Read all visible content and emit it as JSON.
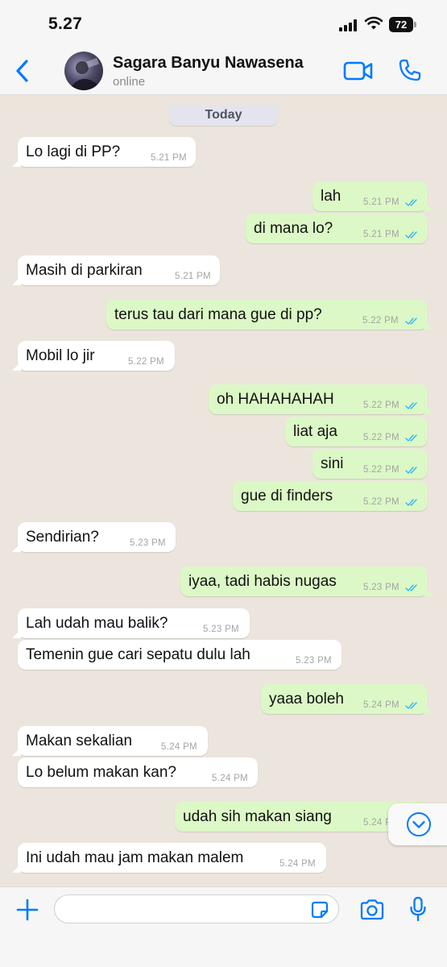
{
  "status_bar": {
    "time": "5.27",
    "battery": "72"
  },
  "header": {
    "contact_name": "Sagara Banyu Nawasena",
    "contact_status": "online"
  },
  "chat": {
    "date_label": "Today",
    "messages": [
      {
        "dir": "in",
        "text": "Lo lagi di PP?",
        "time": "5.21 PM"
      },
      {
        "dir": "out",
        "text": "lah",
        "time": "5.21 PM",
        "read": true
      },
      {
        "dir": "out",
        "text": "di mana lo?",
        "time": "5.21 PM",
        "read": true
      },
      {
        "dir": "in",
        "text": "Masih di parkiran",
        "time": "5.21 PM"
      },
      {
        "dir": "out",
        "text": "terus tau dari mana gue di pp?",
        "time": "5.22 PM",
        "read": true
      },
      {
        "dir": "in",
        "text": "Mobil lo jir",
        "time": "5.22 PM"
      },
      {
        "dir": "out",
        "text": "oh HAHAHAHAH",
        "time": "5.22 PM",
        "read": true
      },
      {
        "dir": "out",
        "text": "liat aja",
        "time": "5.22 PM",
        "read": true
      },
      {
        "dir": "out",
        "text": "sini",
        "time": "5.22 PM",
        "read": true
      },
      {
        "dir": "out",
        "text": "gue di finders",
        "time": "5.22 PM",
        "read": true
      },
      {
        "dir": "in",
        "text": "Sendirian?",
        "time": "5.23 PM"
      },
      {
        "dir": "out",
        "text": "iyaa, tadi habis nugas",
        "time": "5.23 PM",
        "read": true
      },
      {
        "dir": "in",
        "text": "Lah udah mau balik?",
        "time": "5.23 PM"
      },
      {
        "dir": "in",
        "text": "Temenin gue cari sepatu dulu lah",
        "time": "5.23 PM"
      },
      {
        "dir": "out",
        "text": "yaaa boleh",
        "time": "5.24 PM",
        "read": true
      },
      {
        "dir": "in",
        "text": "Makan sekalian",
        "time": "5.24 PM"
      },
      {
        "dir": "in",
        "text": "Lo belum makan kan?",
        "time": "5.24 PM"
      },
      {
        "dir": "out",
        "text": "udah sih makan siang",
        "time": "5.24 PM",
        "read": true
      },
      {
        "dir": "in",
        "text": "Ini udah mau jam makan malem",
        "time": "5.24 PM"
      }
    ]
  },
  "input_bar": {
    "placeholder": "",
    "value": ""
  },
  "colors": {
    "accent": "#007aff",
    "incoming_bubble": "#ffffff",
    "outgoing_bubble": "#dcf8c6",
    "chat_background": "#ece5dd",
    "read_ticks": "#34b7f1"
  },
  "icons": {
    "back": "chevron-left-icon",
    "video": "video-camera-icon",
    "call": "phone-icon",
    "scroll": "chevron-down-icon",
    "plus": "plus-icon",
    "sticker": "sticker-icon",
    "camera": "camera-icon",
    "mic": "microphone-icon"
  }
}
